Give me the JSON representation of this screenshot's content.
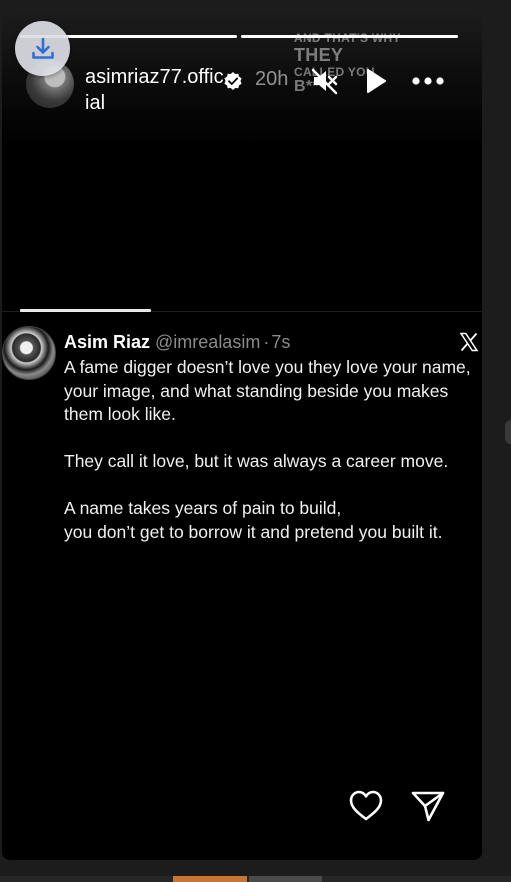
{
  "story": {
    "username": "asimriaz77.official",
    "verified": true,
    "time_ago": "20h",
    "progress": [
      1.0,
      1.0
    ],
    "overlay_text": {
      "line1": "AND THAT'S WHY",
      "line2": "THEY",
      "line3": "CALLED YOU",
      "line4": "B***"
    },
    "controls": {
      "mute_icon": "speaker-muted-icon",
      "play_icon": "play-icon",
      "more_icon": "more-horizontal-icon",
      "download_icon": "download-icon"
    }
  },
  "tweet": {
    "name": "Asim Riaz",
    "handle": "@imrealasim",
    "separator": "·",
    "time": "7s",
    "platform_icon": "x-logo-icon",
    "paragraphs": [
      "A fame digger doesn’t love you they love your name, your image, and what standing beside you makes them look like.",
      "They call it love, but it was always a career move.",
      "A name takes years of pain to build,\nyou don’t get to borrow it and pretend you built it."
    ]
  },
  "actions": {
    "like_icon": "heart-icon",
    "share_icon": "send-icon"
  },
  "colors": {
    "background": "#000000",
    "text": "#f1f1f1",
    "muted_text": "#8b8b8b",
    "thumb_accent": "#c8753a"
  }
}
